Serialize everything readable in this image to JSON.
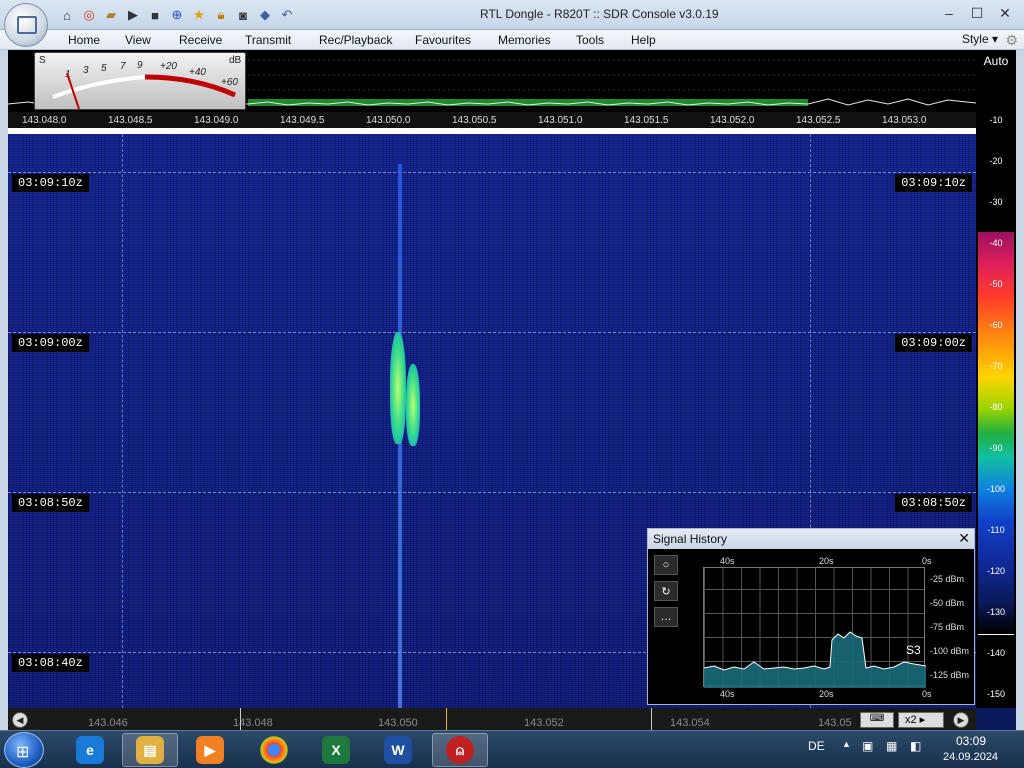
{
  "window": {
    "title": "RTL Dongle - R820T :: SDR Console v3.0.19"
  },
  "menu": {
    "items": [
      "Home",
      "View",
      "Receive",
      "Transmit",
      "Rec/Playback",
      "Favourites",
      "Memories",
      "Tools",
      "Help"
    ],
    "style_label": "Style"
  },
  "smeter": {
    "s_label": "S",
    "db_label": "dB",
    "scale": [
      "1",
      "3",
      "5",
      "7",
      "9",
      "+20",
      "+40",
      "+60"
    ]
  },
  "frequency_axis": [
    "143.048.0",
    "143.048.5",
    "143.049.0",
    "143.049.5",
    "143.050.0",
    "143.050.5",
    "143.051.0",
    "143.051.5",
    "143.052.0",
    "143.052.5",
    "143.053.0"
  ],
  "waterfall": {
    "time_markers": [
      "03:09:10z",
      "03:09:00z",
      "03:08:50z",
      "03:08:40z"
    ]
  },
  "level_scale": {
    "auto_label": "Auto",
    "ticks": [
      "-10",
      "-20",
      "-30",
      "-40",
      "-50",
      "-60",
      "-70",
      "-80",
      "-90",
      "-100",
      "-110",
      "-120",
      "-130",
      "-140",
      "-150"
    ]
  },
  "bottom_axis": {
    "labels": [
      "143.046",
      "143.048",
      "143.050",
      "143.052",
      "143.054",
      "143.05"
    ],
    "zoom_label": "x2"
  },
  "signal_history": {
    "title": "Signal History",
    "x_top": [
      "40s",
      "20s",
      "0s"
    ],
    "x_bottom": [
      "40s",
      "20s",
      "0s"
    ],
    "y_labels": [
      "-25 dBm",
      "-50 dBm",
      "-75 dBm",
      "-100 dBm",
      "-125 dBm"
    ],
    "s_reading": "S3",
    "tools": [
      "record-icon",
      "refresh-icon",
      "more-icon"
    ]
  },
  "taskbar": {
    "lang": "DE",
    "time": "03:09",
    "date": "24.09.2024",
    "apps": [
      "ie-icon",
      "explorer-icon",
      "media-icon",
      "chrome-icon",
      "excel-icon",
      "word-icon",
      "sdr-console-icon"
    ]
  },
  "colors": {
    "waterfall_bg": "#14258f",
    "signal": "#3ff08a",
    "accent": "#2f6cff"
  }
}
